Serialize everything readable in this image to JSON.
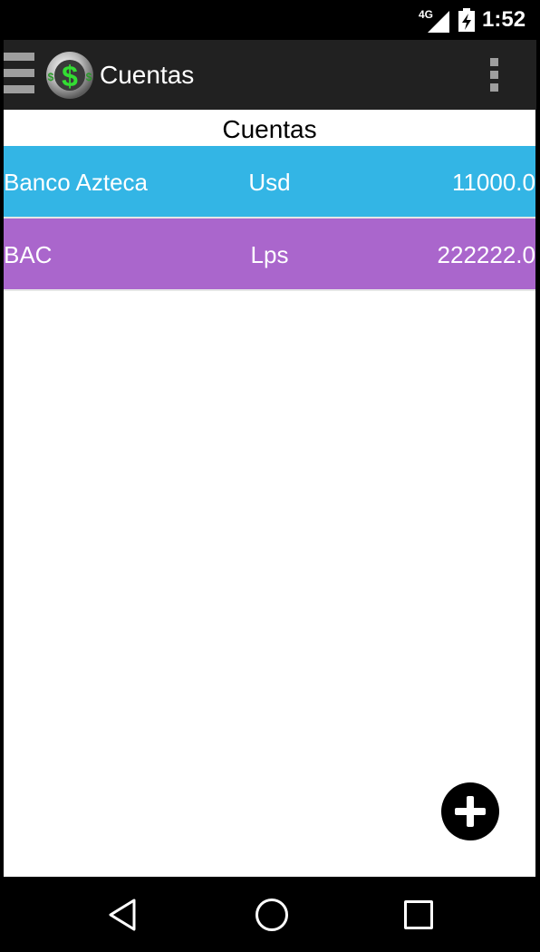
{
  "status_bar": {
    "network_label": "4G",
    "time": "1:52"
  },
  "action_bar": {
    "title": "Cuentas",
    "logo_icon": "dollar-coin-icon",
    "menu_icon": "drawer-menu-icon",
    "overflow_icon": "overflow-menu-icon"
  },
  "main": {
    "section_title": "Cuentas",
    "accounts": [
      {
        "name": "Banco Azteca",
        "currency": "Usd",
        "amount": "11000.0",
        "color": "#33b5e5"
      },
      {
        "name": "BAC",
        "currency": "Lps",
        "amount": "222222.0",
        "color": "#aa66cc"
      }
    ],
    "fab_icon": "add-icon"
  },
  "nav_bar": {
    "back_icon": "back-icon",
    "home_icon": "home-icon",
    "recents_icon": "recents-icon"
  }
}
